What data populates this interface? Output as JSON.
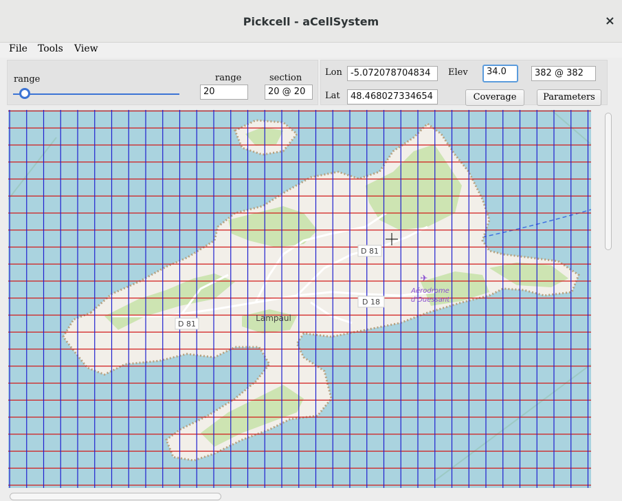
{
  "window": {
    "title": "Pickcell - aCellSystem",
    "close_glyph": "×"
  },
  "menu": [
    "File",
    "Tools",
    "View"
  ],
  "controls": {
    "range_slider_label": "range",
    "range_label": "range",
    "range_value": "20",
    "section_label": "section",
    "section_value": "20 @ 20",
    "lon_label": "Lon",
    "lon_value": "-5.072078704834",
    "lat_label": "Lat",
    "lat_value": "48.468027334654",
    "elev_label": "Elev",
    "elev_value": "34.0",
    "cell_value": "382 @ 382",
    "coverage_button": "Coverage",
    "parameters_button": "Parameters"
  },
  "map": {
    "labels": {
      "d81_top": "D 81",
      "d81_left": "D 81",
      "d18": "D 18",
      "town": "Lampaul",
      "airport_1": "Aérodrome",
      "airport_2": "d'Ouessant"
    },
    "colors": {
      "sea": "#aad3df",
      "land": "#f2efe9",
      "vegetation": "#cde4b2",
      "grid_vertical": "#1f1fcf",
      "grid_horizontal": "#d11a1a"
    }
  }
}
